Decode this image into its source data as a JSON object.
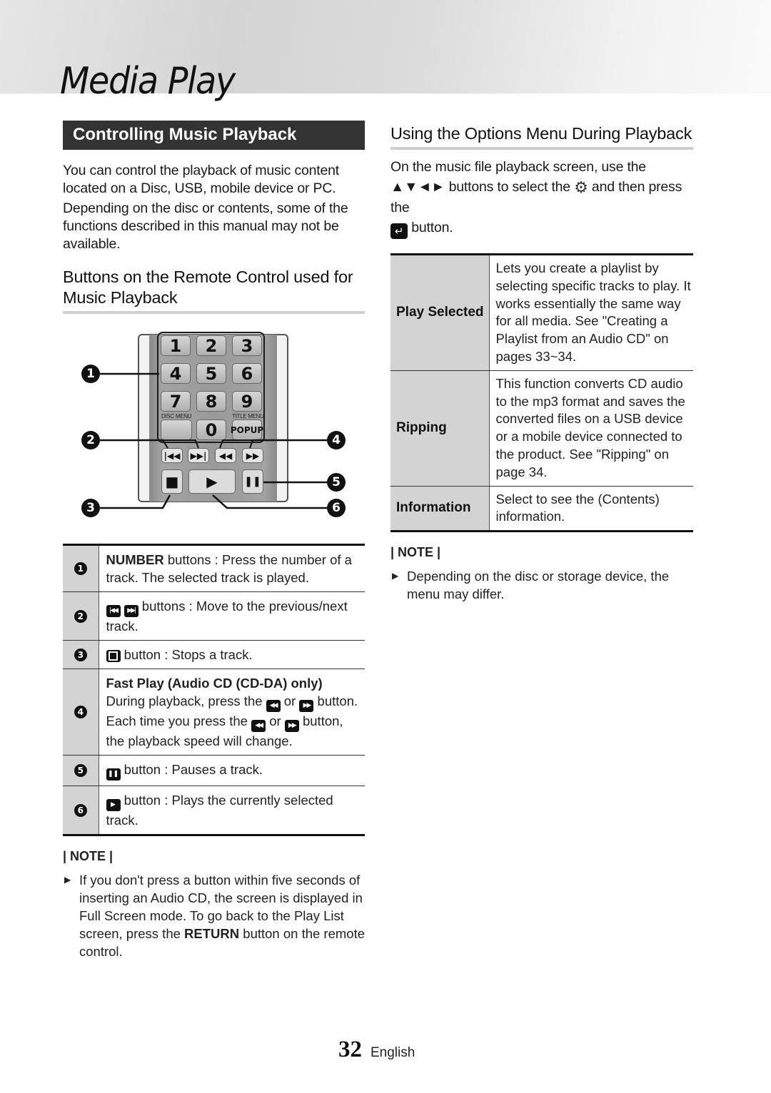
{
  "chapter_title": "Media Play",
  "left": {
    "section_title": "Controlling Music Playback",
    "intro": [
      "You can control the playback of music content located on a Disc, USB, mobile device or PC.",
      "Depending on the disc or contents, some of the functions described in this manual may not be available."
    ],
    "subheading": "Buttons on the Remote Control used for Music Playback",
    "remote": {
      "keys": [
        "1",
        "2",
        "3",
        "4",
        "5",
        "6",
        "7",
        "8",
        "9",
        "0"
      ],
      "disc_menu_label": "DISC MENU",
      "title_menu_label": "TITLE MENU",
      "popup_label": "POPUP",
      "prev_glyph": "|◀◀",
      "next_glyph": "▶▶|",
      "rew_glyph": "◀◀",
      "ff_glyph": "▶▶",
      "stop_glyph": "■",
      "play_glyph": "▶",
      "pause_glyph": "❚❚",
      "callouts": [
        "1",
        "2",
        "3",
        "4",
        "5",
        "6"
      ]
    },
    "key_table": [
      {
        "num": "1",
        "bold_prefix": "NUMBER",
        "text": " buttons : Press the number of a track. The selected track is played."
      },
      {
        "num": "2",
        "icons": [
          "prev-track-icon",
          "next-track-icon"
        ],
        "text": " buttons : Move to the previous/next track."
      },
      {
        "num": "3",
        "icons": [
          "stop-icon"
        ],
        "text": " button : Stops a track."
      },
      {
        "num": "4",
        "title": "Fast Play (Audio CD (CD-DA) only)",
        "line1_a": "During playback, press the ",
        "line1_or": " or ",
        "line1_b": " button.",
        "line2_a": "Each time you press the ",
        "line2_or": " or ",
        "line2_b": " button, the playback speed will change."
      },
      {
        "num": "5",
        "icons": [
          "pause-icon"
        ],
        "text": " button : Pauses a track."
      },
      {
        "num": "6",
        "icons": [
          "play-icon"
        ],
        "text": " button : Plays the currently selected track."
      }
    ],
    "note_label": "| NOTE |",
    "note": {
      "text_before": "If you don't press a button within five seconds of inserting an Audio CD, the screen is displayed in Full Screen mode. To go back to the Play List screen, press the ",
      "bold": "RETURN",
      "text_after": " button on the remote control."
    }
  },
  "right": {
    "heading": "Using the Options Menu During Playback",
    "intro_a": "On the music file playback screen, use the ▲▼◄► buttons to select the ",
    "gear_glyph": "⚙",
    "intro_b": " and then press the",
    "enter_glyph": "↵",
    "intro_c": " button.",
    "options": [
      {
        "name": "Play Selected",
        "desc": "Lets you create a playlist by selecting specific tracks to play. It works essentially the same way for all media. See \"Creating a Playlist from an Audio CD\" on pages 33~34."
      },
      {
        "name": "Ripping",
        "desc": "This function converts CD audio to the mp3 format and saves the converted files on a USB device or a mobile device connected to the product. See \"Ripping\" on page 34."
      },
      {
        "name": "Information",
        "desc": "Select to see the (Contents) information."
      }
    ],
    "note_label": "| NOTE |",
    "note_text": "Depending on the disc or storage device, the menu may differ."
  },
  "footer": {
    "page_number": "32",
    "language": "English"
  }
}
